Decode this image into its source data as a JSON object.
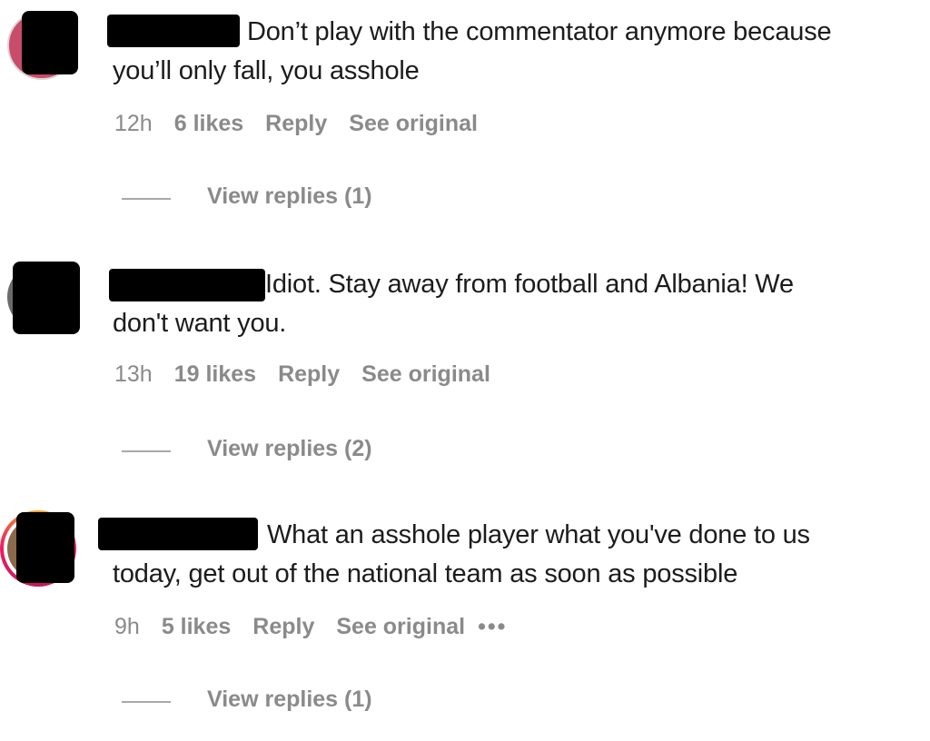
{
  "comments": [
    {
      "text_line1": "Don’t play with the commentator anymore because",
      "text_line2": "you’ll only fall, you asshole",
      "time": "12h",
      "likes": "6 likes",
      "reply": "Reply",
      "see_original": "See original",
      "view_replies": "View replies (1)"
    },
    {
      "text_line1": "Idiot. Stay away from football and Albania! We",
      "text_line2": "don't want you.",
      "time": "13h",
      "likes": "19 likes",
      "reply": "Reply",
      "see_original": "See original",
      "view_replies": "View replies (2)"
    },
    {
      "text_line1": "What an asshole player what you've done to us",
      "text_line2": "today, get out of the national team as soon as possible",
      "time": "9h",
      "likes": "5 likes",
      "reply": "Reply",
      "see_original": "See original",
      "more": "•••",
      "view_replies": "View replies (1)"
    }
  ],
  "colors": {
    "text": "#1c1c1c",
    "meta": "#8a8a8a",
    "redaction": "#000000",
    "story_ring_gradient": [
      "#f9a825",
      "#e91e63",
      "#c2185b"
    ]
  }
}
